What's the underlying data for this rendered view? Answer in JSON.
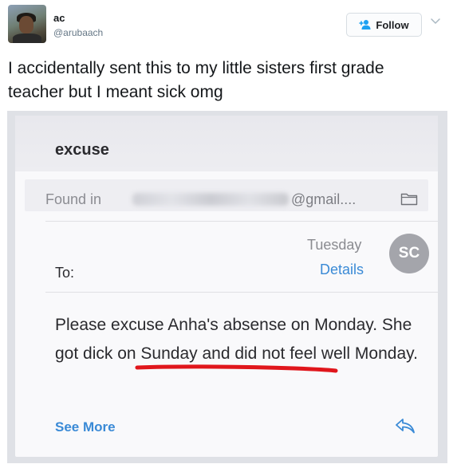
{
  "tweet": {
    "display_name": "ac",
    "handle": "@arubaach",
    "follow_label": "Follow",
    "text": "I accidentally sent this to my little sisters first grade teacher but I meant sick omg"
  },
  "email": {
    "subject": "excuse",
    "found_in_label": "Found in",
    "found_in_domain": "@gmail....",
    "date": "Tuesday",
    "details_label": "Details",
    "avatar_initials": "SC",
    "to_label": "To:",
    "body": "Please excuse Anha's absense on Monday. She got dick on Sunday and did not feel well Monday.",
    "see_more_label": "See More"
  },
  "colors": {
    "twitter_blue": "#1da1f2",
    "link_blue": "#3a8ad6",
    "underline_red": "#e0161c",
    "avatar_gray": "#a4a5ab"
  },
  "icons": [
    "follow-person-icon",
    "chevron-down-icon",
    "folder-icon",
    "reply-arrow-icon"
  ]
}
